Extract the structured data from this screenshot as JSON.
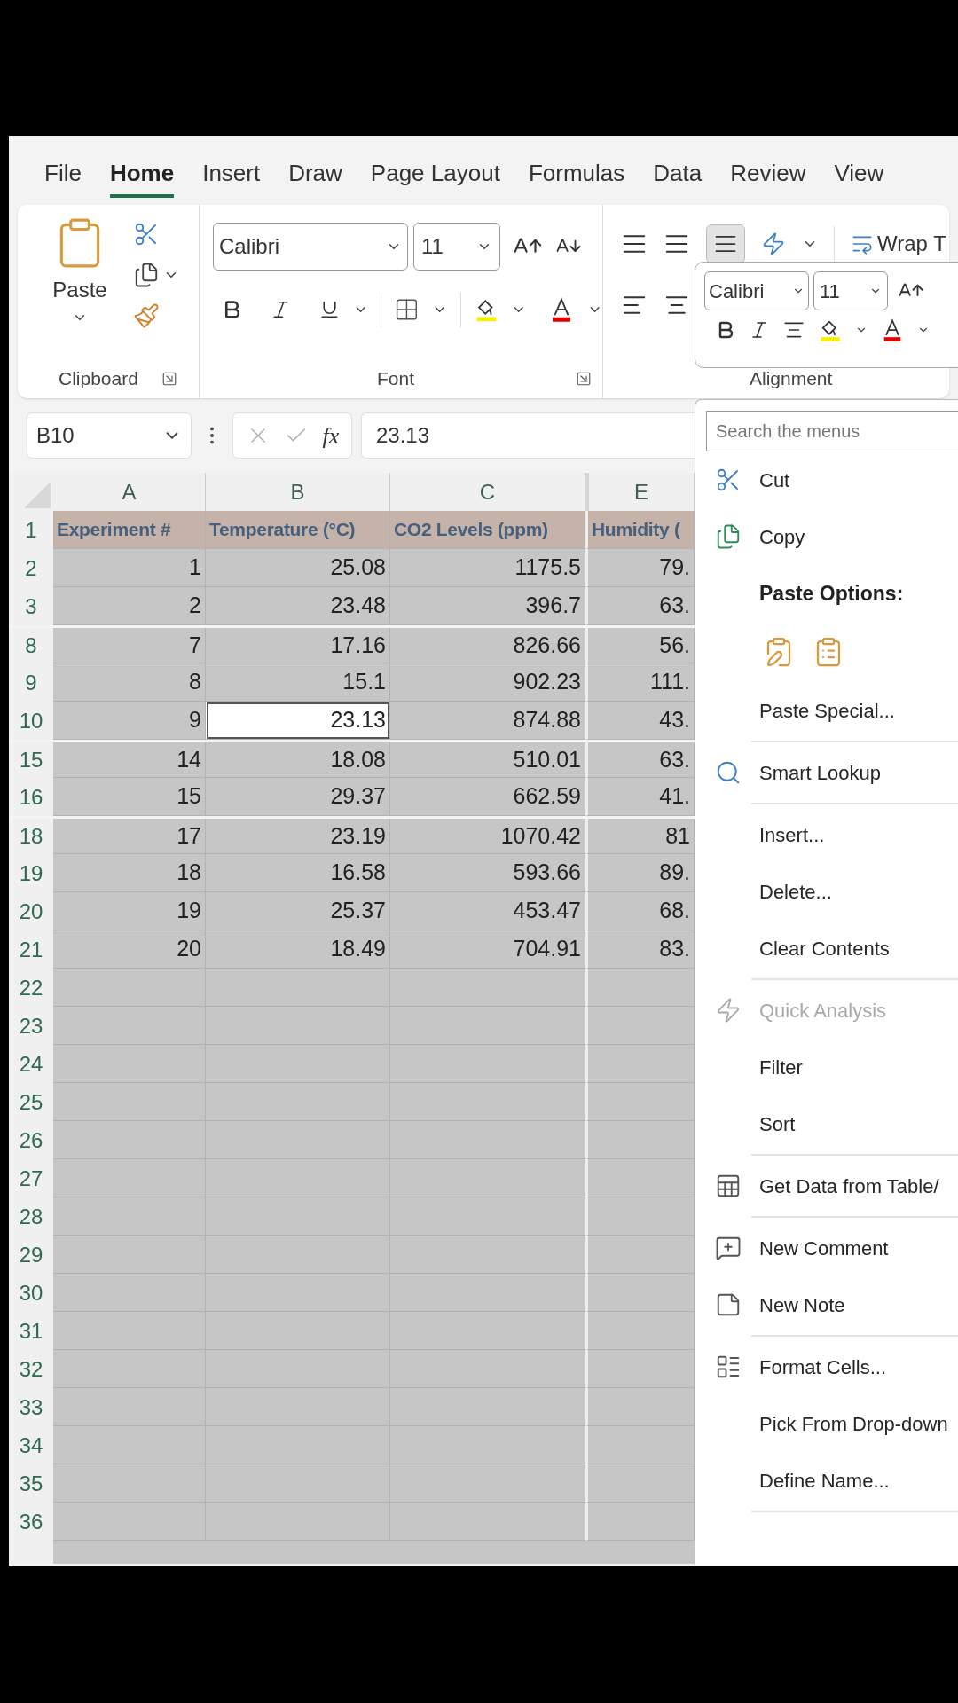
{
  "tabs": [
    {
      "label": "File",
      "selected": false
    },
    {
      "label": "Home",
      "selected": true
    },
    {
      "label": "Insert",
      "selected": false
    },
    {
      "label": "Draw",
      "selected": false
    },
    {
      "label": "Page Layout",
      "selected": false
    },
    {
      "label": "Formulas",
      "selected": false
    },
    {
      "label": "Data",
      "selected": false
    },
    {
      "label": "Review",
      "selected": false
    },
    {
      "label": "View",
      "selected": false
    }
  ],
  "ribbon": {
    "clipboard": {
      "paste_label": "Paste",
      "group_label": "Clipboard"
    },
    "font": {
      "font_name": "Calibri",
      "font_size": "11",
      "group_label": "Font"
    },
    "alignment": {
      "wrap_label": "Wrap T",
      "group_label": "Alignment"
    }
  },
  "mini_toolbar": {
    "font_name": "Calibri",
    "font_size": "11"
  },
  "formula_bar": {
    "name_box": "B10",
    "fx_label": "fx",
    "formula": "23.13"
  },
  "sheet": {
    "columns": [
      {
        "label": "A",
        "hidden_before": false
      },
      {
        "label": "B",
        "hidden_before": false
      },
      {
        "label": "C",
        "hidden_before": false
      },
      {
        "label": "E",
        "hidden_before": true
      }
    ],
    "rows": [
      {
        "number": "1",
        "kind": "header",
        "selected": true,
        "hidden_before": false,
        "cells": [
          "Experiment #",
          "Temperature (°C)",
          "CO2 Levels (ppm)",
          "Humidity ("
        ]
      },
      {
        "number": "2",
        "kind": "data",
        "selected": true,
        "hidden_before": false,
        "cells": [
          "1",
          "25.08",
          "1175.5",
          "79."
        ]
      },
      {
        "number": "3",
        "kind": "data",
        "selected": true,
        "hidden_before": false,
        "cells": [
          "2",
          "23.48",
          "396.7",
          "63."
        ]
      },
      {
        "number": "8",
        "kind": "data",
        "selected": true,
        "hidden_before": true,
        "cells": [
          "7",
          "17.16",
          "826.66",
          "56."
        ]
      },
      {
        "number": "9",
        "kind": "data",
        "selected": true,
        "hidden_before": false,
        "cells": [
          "8",
          "15.1",
          "902.23",
          "111."
        ]
      },
      {
        "number": "10",
        "kind": "data",
        "selected": true,
        "hidden_before": false,
        "active_cell": "23.13",
        "cells": [
          "9",
          "",
          "874.88",
          "43."
        ]
      },
      {
        "number": "15",
        "kind": "data",
        "selected": true,
        "hidden_before": true,
        "cells": [
          "14",
          "18.08",
          "510.01",
          "63."
        ]
      },
      {
        "number": "16",
        "kind": "data",
        "selected": true,
        "hidden_before": false,
        "cells": [
          "15",
          "29.37",
          "662.59",
          "41."
        ]
      },
      {
        "number": "18",
        "kind": "data",
        "selected": true,
        "hidden_before": true,
        "cells": [
          "17",
          "23.19",
          "1070.42",
          "81"
        ]
      },
      {
        "number": "19",
        "kind": "data",
        "selected": true,
        "hidden_before": false,
        "cells": [
          "18",
          "16.58",
          "593.66",
          "89."
        ]
      },
      {
        "number": "20",
        "kind": "data",
        "selected": true,
        "hidden_before": false,
        "cells": [
          "19",
          "25.37",
          "453.47",
          "68."
        ]
      },
      {
        "number": "21",
        "kind": "data",
        "selected": true,
        "hidden_before": false,
        "cells": [
          "20",
          "18.49",
          "704.91",
          "83."
        ]
      },
      {
        "number": "22",
        "kind": "data",
        "selected": true,
        "hidden_before": false,
        "cells": []
      },
      {
        "number": "23",
        "kind": "data",
        "selected": true,
        "hidden_before": false,
        "cells": []
      },
      {
        "number": "24",
        "kind": "data",
        "selected": true,
        "hidden_before": false,
        "cells": []
      },
      {
        "number": "25",
        "kind": "data",
        "selected": true,
        "hidden_before": false,
        "cells": []
      },
      {
        "number": "26",
        "kind": "data",
        "selected": true,
        "hidden_before": false,
        "cells": []
      },
      {
        "number": "27",
        "kind": "data",
        "selected": true,
        "hidden_before": false,
        "cells": []
      },
      {
        "number": "28",
        "kind": "data",
        "selected": true,
        "hidden_before": false,
        "cells": []
      },
      {
        "number": "29",
        "kind": "data",
        "selected": true,
        "hidden_before": false,
        "cells": []
      },
      {
        "number": "30",
        "kind": "data",
        "selected": true,
        "hidden_before": false,
        "cells": []
      },
      {
        "number": "31",
        "kind": "data",
        "selected": true,
        "hidden_before": false,
        "cells": []
      },
      {
        "number": "32",
        "kind": "data",
        "selected": true,
        "hidden_before": false,
        "cells": []
      },
      {
        "number": "33",
        "kind": "data",
        "selected": true,
        "hidden_before": false,
        "cells": []
      },
      {
        "number": "34",
        "kind": "data",
        "selected": true,
        "hidden_before": false,
        "cells": []
      },
      {
        "number": "35",
        "kind": "data",
        "selected": true,
        "hidden_before": false,
        "cells": []
      },
      {
        "number": "36",
        "kind": "data",
        "selected": true,
        "hidden_before": false,
        "cells": []
      }
    ]
  },
  "context_menu": [
    {
      "kind": "search",
      "placeholder": "Search the menus"
    },
    {
      "kind": "item",
      "label": "Cut",
      "disabled": false
    },
    {
      "kind": "item",
      "label": "Copy",
      "disabled": false
    },
    {
      "kind": "header",
      "label": "Paste Options:"
    },
    {
      "kind": "paste_icons"
    },
    {
      "kind": "item",
      "label": "Paste Special...",
      "disabled": false
    },
    {
      "kind": "separator"
    },
    {
      "kind": "item",
      "label": "Smart Lookup",
      "disabled": false
    },
    {
      "kind": "separator"
    },
    {
      "kind": "item",
      "label": "Insert...",
      "disabled": false
    },
    {
      "kind": "item",
      "label": "Delete...",
      "disabled": false
    },
    {
      "kind": "item",
      "label": "Clear Contents",
      "disabled": false
    },
    {
      "kind": "separator"
    },
    {
      "kind": "item",
      "label": "Quick Analysis",
      "disabled": true
    },
    {
      "kind": "item",
      "label": "Filter",
      "disabled": false
    },
    {
      "kind": "item",
      "label": "Sort",
      "disabled": false
    },
    {
      "kind": "separator"
    },
    {
      "kind": "item",
      "label": "Get Data from Table/",
      "disabled": false
    },
    {
      "kind": "separator"
    },
    {
      "kind": "item",
      "label": "New Comment",
      "disabled": false
    },
    {
      "kind": "item",
      "label": "New Note",
      "disabled": false
    },
    {
      "kind": "separator"
    },
    {
      "kind": "item",
      "label": "Format Cells...",
      "disabled": false
    },
    {
      "kind": "item",
      "label": "Pick From Drop-down",
      "disabled": false
    },
    {
      "kind": "item",
      "label": "Define Name...",
      "disabled": false
    },
    {
      "kind": "separator"
    }
  ]
}
